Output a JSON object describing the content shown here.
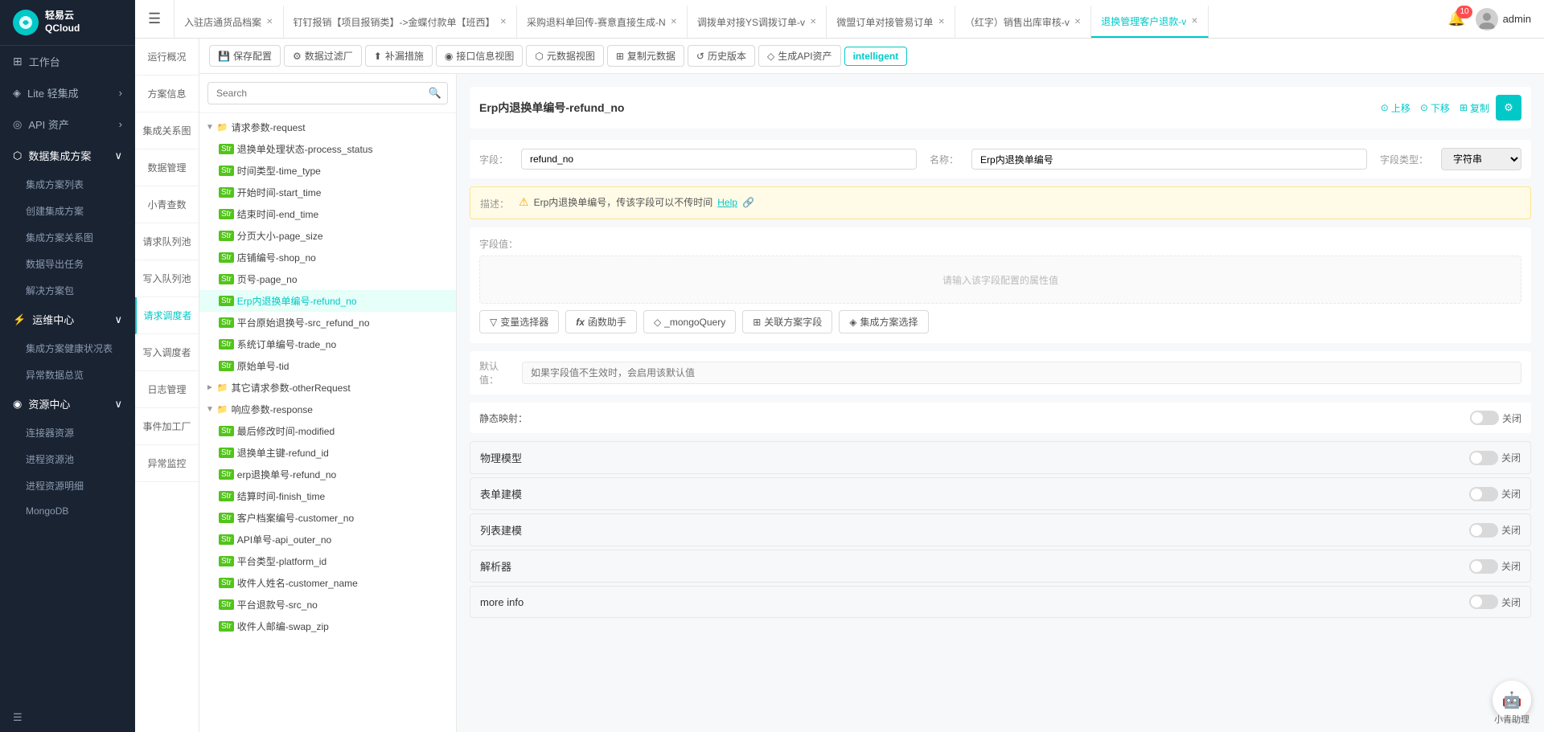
{
  "sidebar": {
    "logo": "轻易云\nQCloud",
    "items": [
      {
        "id": "workspace",
        "label": "工作台",
        "icon": "⊞",
        "expandable": false
      },
      {
        "id": "lite",
        "label": "Lite 轻集成",
        "icon": "◈",
        "expandable": true
      },
      {
        "id": "api",
        "label": "API 资产",
        "icon": "◎",
        "expandable": true
      },
      {
        "id": "data-integration",
        "label": "数据集成方案",
        "icon": "⬡",
        "expandable": true,
        "active": true
      },
      {
        "id": "integration-list",
        "label": "集成方案列表",
        "sub": true
      },
      {
        "id": "create-integration",
        "label": "创建集成方案",
        "sub": true
      },
      {
        "id": "integration-relation",
        "label": "集成方案关系图",
        "sub": true
      },
      {
        "id": "data-export",
        "label": "数据导出任务",
        "sub": true
      },
      {
        "id": "solution-package",
        "label": "解决方案包",
        "sub": true
      },
      {
        "id": "ops",
        "label": "运维中心",
        "icon": "⚡",
        "expandable": true
      },
      {
        "id": "health-status",
        "label": "集成方案健康状况表",
        "sub": true
      },
      {
        "id": "anomaly-data",
        "label": "异常数据总览",
        "sub": true
      },
      {
        "id": "resource-center",
        "label": "资源中心",
        "icon": "◉",
        "expandable": true
      },
      {
        "id": "connector-resource",
        "label": "连接器资源",
        "sub": true
      },
      {
        "id": "process-pool",
        "label": "进程资源池",
        "sub": true
      },
      {
        "id": "process-detail",
        "label": "进程资源明细",
        "sub": true
      },
      {
        "id": "mongodb",
        "label": "MongoDB",
        "sub": true
      }
    ]
  },
  "topbar": {
    "hamburger": "☰",
    "tabs": [
      {
        "id": "tab1",
        "label": "入驻店通货品档案",
        "closable": true
      },
      {
        "id": "tab2",
        "label": "钉钉报销【项目报销类】->金蝶付款单【班西】",
        "closable": true
      },
      {
        "id": "tab3",
        "label": "采购退料单回传-赛意直接生成-N",
        "closable": true
      },
      {
        "id": "tab4",
        "label": "调拨单对接YS调拨订单-v",
        "closable": true
      },
      {
        "id": "tab5",
        "label": "微盟订单对接管易订单",
        "closable": true
      },
      {
        "id": "tab6",
        "label": "（红字）销售出库审核-v",
        "closable": true
      },
      {
        "id": "tab7",
        "label": "退换管理客户退款-v",
        "closable": true,
        "active": true
      }
    ],
    "more_btn": "···",
    "notification_count": "10",
    "username": "admin"
  },
  "left_nav": {
    "items": [
      {
        "id": "overview",
        "label": "运行概况"
      },
      {
        "id": "plan-info",
        "label": "方案信息"
      },
      {
        "id": "integration-map",
        "label": "集成关系图"
      },
      {
        "id": "data-mgmt",
        "label": "数据管理"
      },
      {
        "id": "xiao-qing",
        "label": "小青查数"
      },
      {
        "id": "request-queue",
        "label": "请求队列池",
        "active": true
      },
      {
        "id": "write-queue",
        "label": "写入队列池"
      },
      {
        "id": "request-debugger",
        "label": "请求调度者",
        "active_nav": true
      },
      {
        "id": "write-debugger",
        "label": "写入调度者"
      },
      {
        "id": "log-mgmt",
        "label": "日志管理"
      },
      {
        "id": "event-factory",
        "label": "事件加工厂"
      },
      {
        "id": "anomaly-monitor",
        "label": "异常监控"
      }
    ]
  },
  "toolbar": {
    "buttons": [
      {
        "id": "save-config",
        "label": "保存配置",
        "icon": "💾"
      },
      {
        "id": "data-filter",
        "label": "数据过滤厂",
        "icon": "⚙"
      },
      {
        "id": "supplement",
        "label": "补漏措施",
        "icon": "⬆"
      },
      {
        "id": "interface-view",
        "label": "接口信息视图",
        "icon": "◉"
      },
      {
        "id": "meta-view",
        "label": "元数据视图",
        "icon": "⬡"
      },
      {
        "id": "copy-data",
        "label": "复制元数据",
        "icon": "⊞"
      },
      {
        "id": "history",
        "label": "历史版本",
        "icon": "↺"
      },
      {
        "id": "gen-api",
        "label": "生成API资产",
        "icon": "◇"
      },
      {
        "id": "intelligent",
        "label": "intelligent",
        "highlight": true
      }
    ]
  },
  "tree": {
    "search_placeholder": "Search",
    "nodes": [
      {
        "id": "request-params",
        "label": "请求参数-request",
        "type": "folder",
        "level": 0,
        "expanded": true
      },
      {
        "id": "process-status",
        "label": "退换单处理状态-process_status",
        "type": "str",
        "level": 1
      },
      {
        "id": "time-type",
        "label": "时间类型-time_type",
        "type": "str",
        "level": 1
      },
      {
        "id": "start-time",
        "label": "开始时间-start_time",
        "type": "str",
        "level": 1
      },
      {
        "id": "end-time",
        "label": "结束时间-end_time",
        "type": "str",
        "level": 1
      },
      {
        "id": "page-size",
        "label": "分页大小-page_size",
        "type": "str",
        "level": 1
      },
      {
        "id": "shop-no",
        "label": "店铺编号-shop_no",
        "type": "str",
        "level": 1
      },
      {
        "id": "page-no",
        "label": "页号-page_no",
        "type": "str",
        "level": 1
      },
      {
        "id": "refund-no",
        "label": "Erp内退换单编号-refund_no",
        "type": "str",
        "level": 1,
        "selected": true
      },
      {
        "id": "src-refund-no",
        "label": "平台原始退换号-src_refund_no",
        "type": "str",
        "level": 1
      },
      {
        "id": "trade-no",
        "label": "系统订单编号-trade_no",
        "type": "str",
        "level": 1
      },
      {
        "id": "tid",
        "label": "原始单号-tid",
        "type": "str",
        "level": 1
      },
      {
        "id": "other-request",
        "label": "其它请求参数-otherRequest",
        "type": "folder",
        "level": 0
      },
      {
        "id": "response",
        "label": "响应参数-response",
        "type": "folder",
        "level": 0,
        "expanded": true
      },
      {
        "id": "modified",
        "label": "最后修改时间-modified",
        "type": "str",
        "level": 1
      },
      {
        "id": "refund-id",
        "label": "退换单主键-refund_id",
        "type": "str",
        "level": 1
      },
      {
        "id": "erp-refund-no",
        "label": "erp退换单号-refund_no",
        "type": "str",
        "level": 1
      },
      {
        "id": "finish-time",
        "label": "结算时间-finish_time",
        "type": "str",
        "level": 1
      },
      {
        "id": "customer-no",
        "label": "客户档案编号-customer_no",
        "type": "str",
        "level": 1
      },
      {
        "id": "api-outer-no",
        "label": "API单号-api_outer_no",
        "type": "str",
        "level": 1
      },
      {
        "id": "platform-id",
        "label": "平台类型-platform_id",
        "type": "str",
        "level": 1
      },
      {
        "id": "customer-name",
        "label": "收件人姓名-customer_name",
        "type": "str",
        "level": 1
      },
      {
        "id": "src-no",
        "label": "平台退款号-src_no",
        "type": "str",
        "level": 1
      },
      {
        "id": "swap-zip",
        "label": "收件人邮编-swap_zip",
        "type": "str",
        "level": 1
      }
    ]
  },
  "detail": {
    "title": "Erp内退换单编号-refund_no",
    "actions": {
      "up": "上移",
      "down": "下移",
      "copy": "复制"
    },
    "field_label": "字段：",
    "field_value": "refund_no",
    "name_label": "名称：",
    "name_value": "Erp内退换单编号",
    "type_label": "字段类型：",
    "type_value": "字符串",
    "desc_label": "描述：",
    "desc_text": "Erp内退换单编号，传该字段可以不传时间",
    "desc_help": "Help",
    "field_value_label": "字段值：",
    "field_value_placeholder": "请输入该字段配置的属性值",
    "fv_buttons": [
      {
        "id": "var-selector",
        "label": "变量选择器",
        "icon": "▽"
      },
      {
        "id": "func-helper",
        "label": "函数助手",
        "icon": "fx"
      },
      {
        "id": "mongo-query",
        "label": "_mongoQuery",
        "icon": "◇"
      },
      {
        "id": "related-field",
        "label": "关联方案字段",
        "icon": "⊞"
      },
      {
        "id": "integration-select",
        "label": "集成方案选择",
        "icon": "◈"
      }
    ],
    "default_label": "默认值：",
    "default_placeholder": "如果字段值不生效时，会启用该默认值",
    "static_map_label": "静态映射：",
    "static_map_value": "关闭",
    "sections": [
      {
        "id": "physical-model",
        "label": "物理模型",
        "toggle": "关闭"
      },
      {
        "id": "form-build",
        "label": "表单建模",
        "toggle": "关闭"
      },
      {
        "id": "list-build",
        "label": "列表建模",
        "toggle": "关闭"
      },
      {
        "id": "parser",
        "label": "解析器",
        "toggle": "关闭"
      },
      {
        "id": "more-info",
        "label": "more info",
        "toggle": "关闭"
      }
    ]
  },
  "colors": {
    "accent": "#00c9c8",
    "sidebar_bg": "#1a2332",
    "active_bg": "#e6f7ff",
    "warning_bg": "#fffbe6",
    "warning_border": "#ffe58f"
  }
}
